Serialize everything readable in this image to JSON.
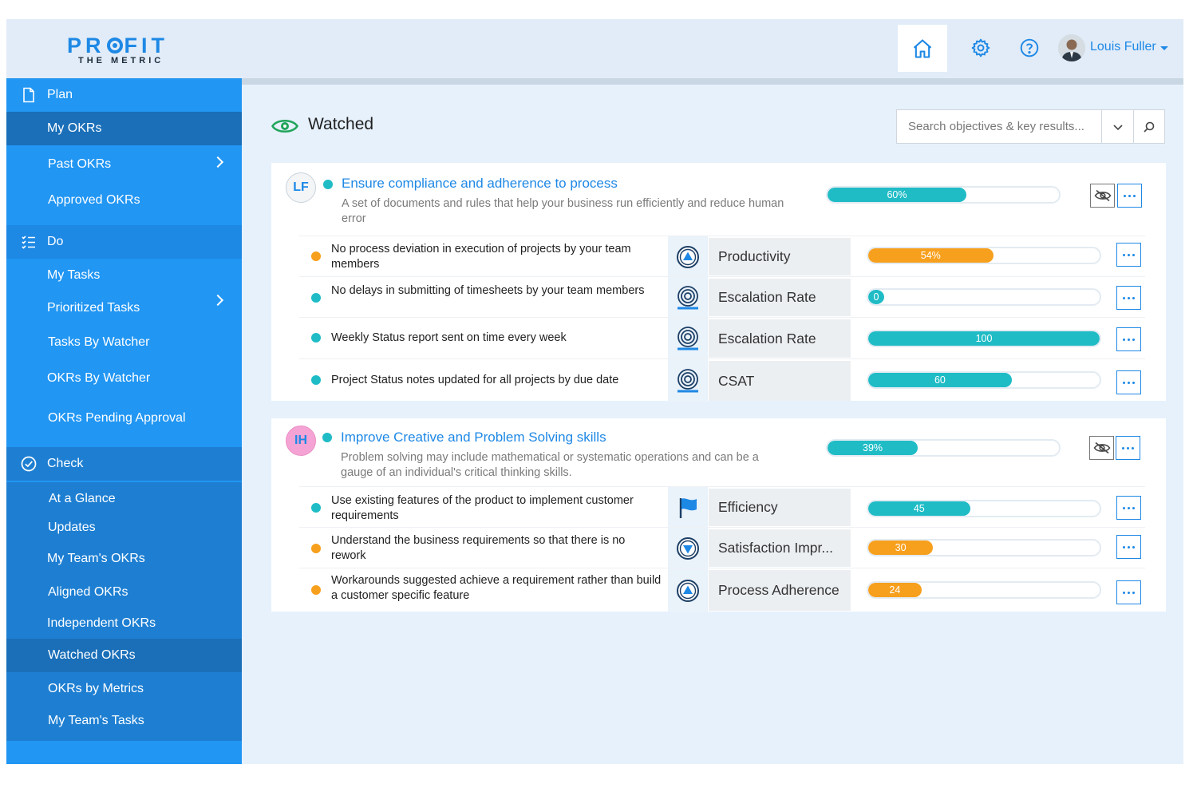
{
  "brand": {
    "logo_main_a": "PR",
    "logo_main_b": "FIT",
    "logo_sub": "THE METRIC"
  },
  "header": {
    "user_name": "Louis Fuller"
  },
  "sidebar": {
    "plan": {
      "label": "Plan",
      "items": [
        "My OKRs",
        "Past OKRs",
        "Approved OKRs"
      ]
    },
    "do": {
      "label": "Do",
      "items": [
        "My Tasks",
        "Prioritized Tasks",
        "Tasks By Watcher",
        "OKRs By Watcher",
        "OKRs Pending Approval"
      ]
    },
    "check": {
      "label": "Check",
      "items": [
        "At a Glance",
        "Updates",
        "My Team's OKRs",
        "Aligned OKRs",
        "Independent OKRs",
        "Watched OKRs",
        "OKRs by Metrics",
        "My Team's Tasks"
      ]
    }
  },
  "page": {
    "title": "Watched"
  },
  "search": {
    "placeholder": "Search objectives & key results..."
  },
  "colors": {
    "teal": "#1fbcc6",
    "orange": "#f7a01e",
    "blue": "#1e88e5"
  },
  "objectives": [
    {
      "initials": "LF",
      "title": "Ensure compliance and adherence to process",
      "description": "A set of documents and rules that help your business run efficiently and reduce human error",
      "progress": 60,
      "progress_label": "60%",
      "key_results": [
        {
          "text": "No process deviation in execution of projects by your team members",
          "status": "orange",
          "metric_icon": "triangle-up-icon",
          "metric": "Productivity",
          "value": 54,
          "label": "54%"
        },
        {
          "text": "No delays in submitting of timesheets by your team members",
          "status": "teal",
          "metric_icon": "target-icon",
          "metric": "Escalation Rate",
          "value": 0,
          "label": "0"
        },
        {
          "text": "Weekly Status report sent on time every week",
          "status": "teal",
          "metric_icon": "target-icon",
          "metric": "Escalation Rate",
          "value": 100,
          "label": "100"
        },
        {
          "text": "Project Status notes updated for all projects by due date",
          "status": "teal",
          "metric_icon": "target-icon",
          "metric": "CSAT",
          "value": 62,
          "label": "60"
        }
      ]
    },
    {
      "initials": "IH",
      "title": "Improve Creative and Problem Solving skills",
      "description": "Problem solving may include mathematical or systematic operations and can be a gauge of an individual's critical thinking skills.",
      "progress": 39,
      "progress_label": "39%",
      "key_results": [
        {
          "text": "Use existing features of the product to implement customer requirements",
          "status": "teal",
          "metric_icon": "flag-icon",
          "metric": "Efficiency",
          "value": 44,
          "label": "45"
        },
        {
          "text": "Understand the business requirements so that there is no rework",
          "status": "orange",
          "metric_icon": "triangle-down-icon",
          "metric": "Satisfaction Impr...",
          "value": 28,
          "label": "30"
        },
        {
          "text": "Workarounds suggested achieve a requirement rather than build a customer specific feature",
          "status": "orange",
          "metric_icon": "triangle-up-icon",
          "metric": "Process Adherence",
          "value": 23,
          "label": "24"
        }
      ]
    }
  ]
}
